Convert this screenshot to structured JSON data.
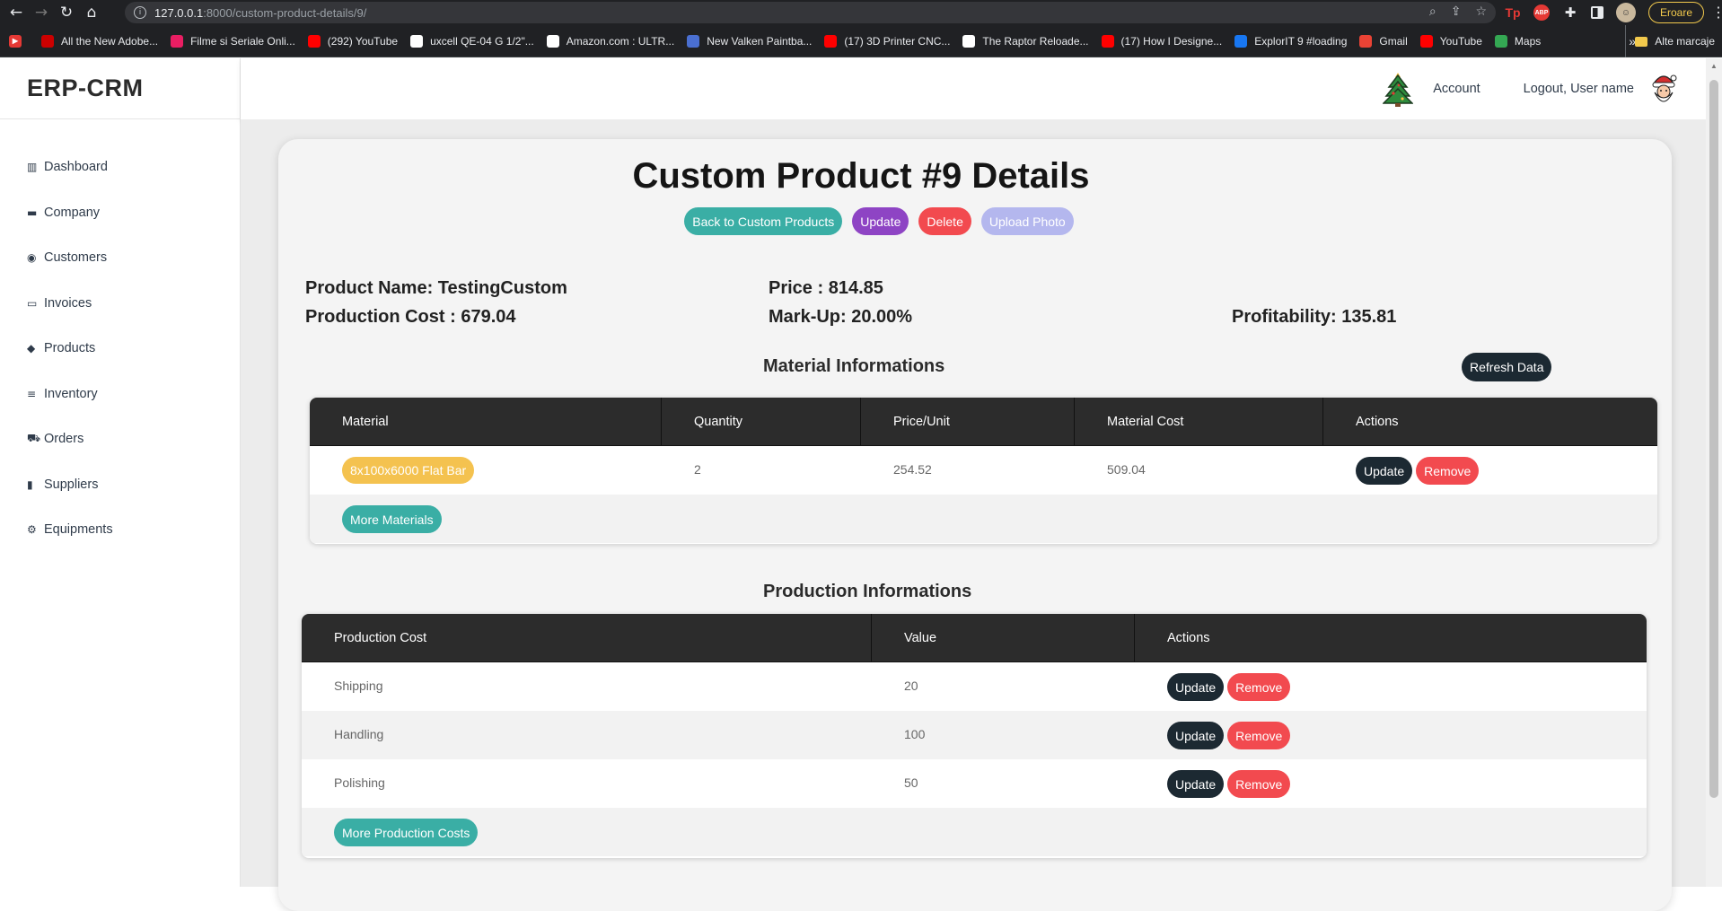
{
  "browser": {
    "url_host": "127.0.0.1",
    "url_path": ":8000/custom-product-details/9/",
    "error_label": "Eroare",
    "bookmarks": [
      {
        "label": "All the New Adobe...",
        "color": "#c00"
      },
      {
        "label": "Filme si Seriale Onli...",
        "color": "#e91e63"
      },
      {
        "label": "(292) YouTube",
        "color": "#f00"
      },
      {
        "label": "uxcell QE-04 G 1/2\"...",
        "color": "#fff"
      },
      {
        "label": "Amazon.com : ULTR...",
        "color": "#fff"
      },
      {
        "label": "New Valken Paintba...",
        "color": "#4a6fd1"
      },
      {
        "label": "(17) 3D Printer CNC...",
        "color": "#f00"
      },
      {
        "label": "The Raptor Reloade...",
        "color": "#fff"
      },
      {
        "label": "(17) How I Designe...",
        "color": "#f00"
      },
      {
        "label": "ExplorIT 9 #loading",
        "color": "#1877f2"
      },
      {
        "label": "Gmail",
        "color": "#ea4335"
      },
      {
        "label": "YouTube",
        "color": "#f00"
      },
      {
        "label": "Maps",
        "color": "#34a853"
      }
    ],
    "more_label": "»",
    "other_bookmarks": "Alte marcaje"
  },
  "app": {
    "brand": "ERP-CRM",
    "sidebar": [
      {
        "label": "Dashboard",
        "icon": "chart-bar-icon",
        "glyph": "▥"
      },
      {
        "label": "Company",
        "icon": "folder-icon",
        "glyph": "▬"
      },
      {
        "label": "Customers",
        "icon": "user-circle-icon",
        "glyph": "◉"
      },
      {
        "label": "Invoices",
        "icon": "folder-open-icon",
        "glyph": "▭"
      },
      {
        "label": "Products",
        "icon": "tags-icon",
        "glyph": "◆"
      },
      {
        "label": "Inventory",
        "icon": "list-icon",
        "glyph": "≡"
      },
      {
        "label": "Orders",
        "icon": "cart-icon",
        "glyph": "⛟"
      },
      {
        "label": "Suppliers",
        "icon": "truck-icon",
        "glyph": "▮"
      },
      {
        "label": "Equipments",
        "icon": "gears-icon",
        "glyph": "⚙"
      }
    ],
    "topbar": {
      "account": "Account",
      "logout": "Logout, User name"
    }
  },
  "page": {
    "title": "Custom Product #9 Details",
    "buttons": {
      "back": "Back to Custom Products",
      "update": "Update",
      "delete": "Delete",
      "upload": "Upload Photo"
    },
    "info": {
      "product_name": "Product Name: TestingCustom",
      "price": "Price : 814.85",
      "production_cost": "Production Cost : 679.04",
      "markup": "Mark-Up: 20.00%",
      "profitability": "Profitability: 135.81"
    },
    "materials": {
      "title": "Material Informations",
      "refresh": "Refresh Data",
      "headers": [
        "Material",
        "Quantity",
        "Price/Unit",
        "Material Cost",
        "Actions"
      ],
      "rows": [
        {
          "material": "8x100x6000 Flat Bar",
          "quantity": "2",
          "price_unit": "254.52",
          "cost": "509.04"
        }
      ],
      "more": "More Materials"
    },
    "production": {
      "title": "Production Informations",
      "headers": [
        "Production Cost",
        "Value",
        "Actions"
      ],
      "rows": [
        {
          "name": "Shipping",
          "value": "20"
        },
        {
          "name": "Handling",
          "value": "100"
        },
        {
          "name": "Polishing",
          "value": "50"
        }
      ],
      "more": "More Production Costs"
    },
    "row_actions": {
      "update": "Update",
      "remove": "Remove"
    }
  }
}
